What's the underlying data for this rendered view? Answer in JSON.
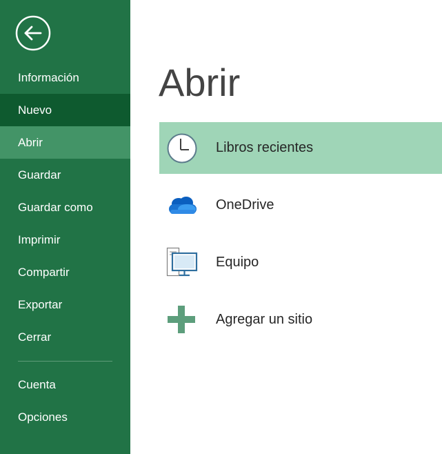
{
  "sidebar": {
    "back_icon": "back-arrow-icon",
    "items": [
      {
        "label": "Información"
      },
      {
        "label": "Nuevo"
      },
      {
        "label": "Abrir"
      },
      {
        "label": "Guardar"
      },
      {
        "label": "Guardar como"
      },
      {
        "label": "Imprimir"
      },
      {
        "label": "Compartir"
      },
      {
        "label": "Exportar"
      },
      {
        "label": "Cerrar"
      }
    ],
    "bottom_items": [
      {
        "label": "Cuenta"
      },
      {
        "label": "Opciones"
      }
    ],
    "selected": "Abrir",
    "hovered": "Nuevo"
  },
  "main": {
    "title": "Abrir",
    "locations": [
      {
        "label": "Libros recientes",
        "icon": "clock-icon",
        "selected": true
      },
      {
        "label": "OneDrive",
        "icon": "onedrive-cloud-icon"
      },
      {
        "label": "Equipo",
        "icon": "computer-icon"
      },
      {
        "label": "Agregar un sitio",
        "icon": "plus-icon"
      }
    ]
  },
  "colors": {
    "sidebar_bg": "#217346",
    "sidebar_hover": "#0e5a2f",
    "sidebar_selected": "#439467",
    "location_selected": "#9fd5b7",
    "accent_green": "#5d9e7c",
    "onedrive_blue": "#1a73d1"
  }
}
